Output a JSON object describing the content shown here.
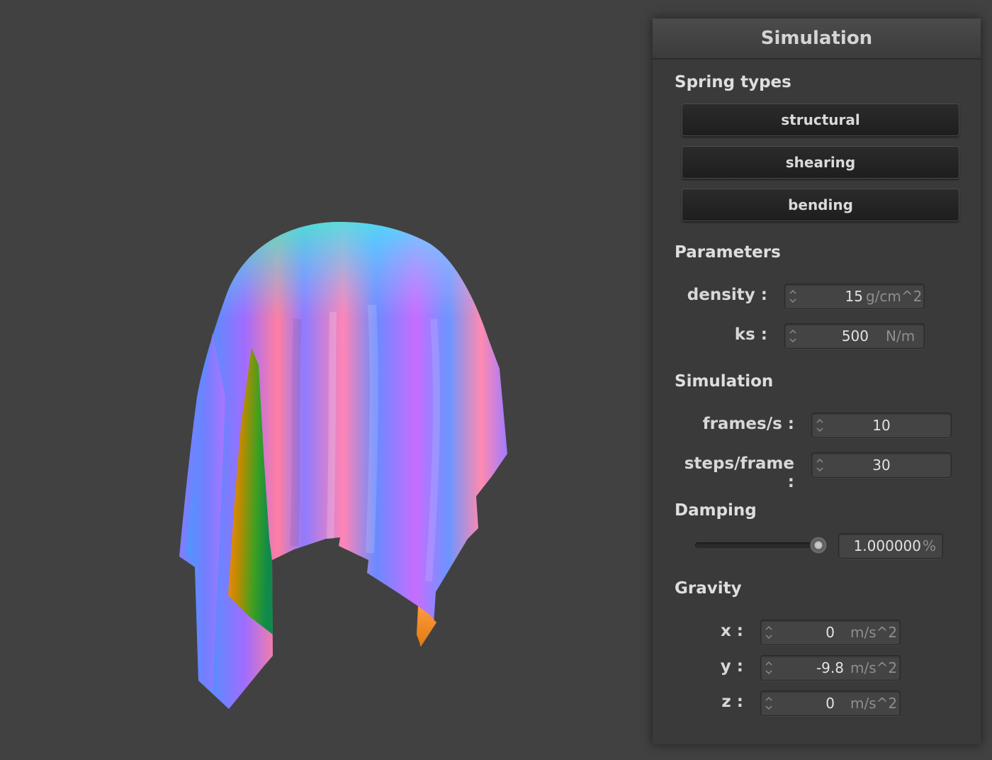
{
  "panel": {
    "title": "Simulation",
    "spring_types": {
      "label": "Spring types",
      "buttons": [
        "structural",
        "shearing",
        "bending"
      ]
    },
    "parameters": {
      "label": "Parameters",
      "density": {
        "label": "density :",
        "value": "15",
        "unit": "g/cm^2"
      },
      "ks": {
        "label": "ks :",
        "value": "500",
        "unit": "N/m"
      }
    },
    "simulation": {
      "label": "Simulation",
      "fps": {
        "label": "frames/s :",
        "value": "10"
      },
      "steps": {
        "label": "steps/frame :",
        "value": "30"
      }
    },
    "damping": {
      "label": "Damping",
      "value": "1.000000",
      "unit": "%",
      "slider_fraction": 0.99
    },
    "gravity": {
      "label": "Gravity",
      "x": {
        "label": "x :",
        "value": "0",
        "unit": "m/s^2"
      },
      "y": {
        "label": "y :",
        "value": "-9.8",
        "unit": "m/s^2"
      },
      "z": {
        "label": "z :",
        "value": "0",
        "unit": "m/s^2"
      }
    }
  },
  "colors": {
    "background": "#414141",
    "panel": "#3a3a3a"
  }
}
